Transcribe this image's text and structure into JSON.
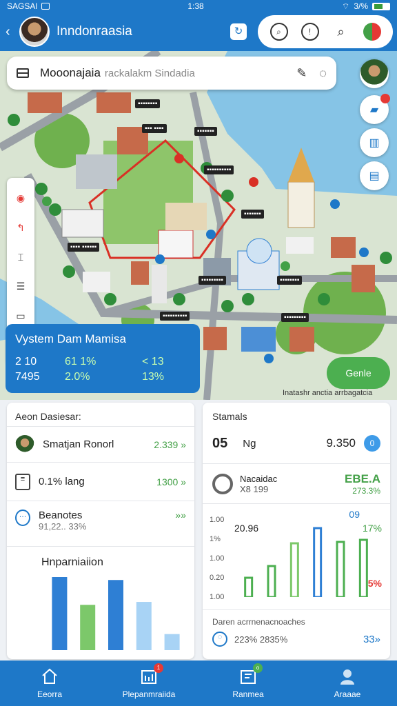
{
  "status_bar": {
    "left_text": "SAGSAl",
    "time": "1:38",
    "battery": "3/%"
  },
  "header": {
    "title": "Inndonraasia",
    "icons": [
      "sync-icon",
      "search-icon",
      "info-icon",
      "search-icon",
      "flag-icon"
    ]
  },
  "map": {
    "search": {
      "title": "Mooonajaia",
      "subtitle": "rackalakm Sindadia"
    },
    "labels": [
      {
        "text": "▪▪▪▪▪▪▪▪"
      },
      {
        "text": "▪▪▪ ▪▪▪▪"
      },
      {
        "text": "▪▪▪▪▪▪▪"
      },
      {
        "text": "▪▪▪▪▪▪▪▪▪▪"
      },
      {
        "text": "▪▪▪▪▪▪▪"
      },
      {
        "text": "▪▪▪▪ ▪▪▪▪▪▪"
      },
      {
        "text": "▪▪▪▪▪▪▪▪▪"
      },
      {
        "text": "▪▪▪▪▪▪▪▪"
      },
      {
        "text": "▪▪▪▪▪▪▪▪▪▪"
      },
      {
        "text": "▪▪▪▪▪▪▪▪▪"
      }
    ],
    "stats_card": {
      "title": "Vystem Dam Mamisa",
      "row1": [
        "2 10",
        "61 1%",
        "< 13"
      ],
      "row2": [
        "7495",
        "2.0%",
        "13%"
      ]
    },
    "go_button": "Genle",
    "bottom_text": "Inatashr anctia arrbagatcia"
  },
  "left_panel": {
    "header": "Aeon Dasiesar:",
    "rows": [
      {
        "label": "Smatjan Ronorl",
        "value": "2.339 »"
      },
      {
        "label": "0.1% lang",
        "value": "1300 »"
      },
      {
        "label": "Beanotes",
        "sub": "91,22.. 33%",
        "value": "»»"
      }
    ],
    "chart": {
      "title": "Hnparniaiion"
    }
  },
  "right_panel": {
    "title": "Stamals",
    "row1": {
      "big": "05",
      "label": "Ng",
      "value": "9.350",
      "badge": "0"
    },
    "row2": {
      "label": "Nacaidac",
      "sub": "X8 199",
      "value": "EBE.A",
      "value_sub": "273.3%"
    },
    "chart_labels": {
      "left": [
        "1.00",
        "1%",
        "1.00",
        "0.20",
        "1.00"
      ],
      "inner": "20.96",
      "right_top": "09",
      "right_mid": "17%",
      "right_low": "55%"
    },
    "footer": {
      "text": "Daren acrrnenacnoaches",
      "sub": "223% 2835%",
      "value": "33»"
    }
  },
  "chart_data": [
    {
      "type": "bar",
      "title": "Hnparniaiion",
      "categories": [
        "1",
        "2",
        "3",
        "4",
        "5"
      ],
      "series": [
        {
          "values": [
            100,
            62,
            96,
            66,
            22
          ]
        }
      ],
      "colors": [
        "#2e7fd4",
        "#7cc86a",
        "#2e7fd4",
        "#a8d3f5",
        "#a8d3f5"
      ],
      "ylim": [
        0,
        100
      ]
    },
    {
      "type": "bar",
      "categories": [
        "1",
        "2",
        "3",
        "4",
        "5",
        "6"
      ],
      "series": [
        {
          "values": [
            28,
            45,
            78,
            100,
            80,
            83
          ]
        }
      ],
      "colors": [
        "#4caf50",
        "#4caf50",
        "#7cc86a",
        "#2e7fd4",
        "#4caf50",
        "#4caf50"
      ],
      "ylim": [
        0,
        100
      ]
    }
  ],
  "bottom_nav": {
    "items": [
      {
        "label": "Eeorra",
        "icon": "home-icon"
      },
      {
        "label": "Plepanmraiida",
        "icon": "calendar-icon",
        "badge": "1"
      },
      {
        "label": "Ranmea",
        "icon": "chart-icon",
        "badge": "o"
      },
      {
        "label": "Araaae",
        "icon": "user-icon"
      }
    ]
  },
  "colors": {
    "primary": "#1e78c8",
    "accent_green": "#4caf50",
    "red": "#e53935"
  }
}
